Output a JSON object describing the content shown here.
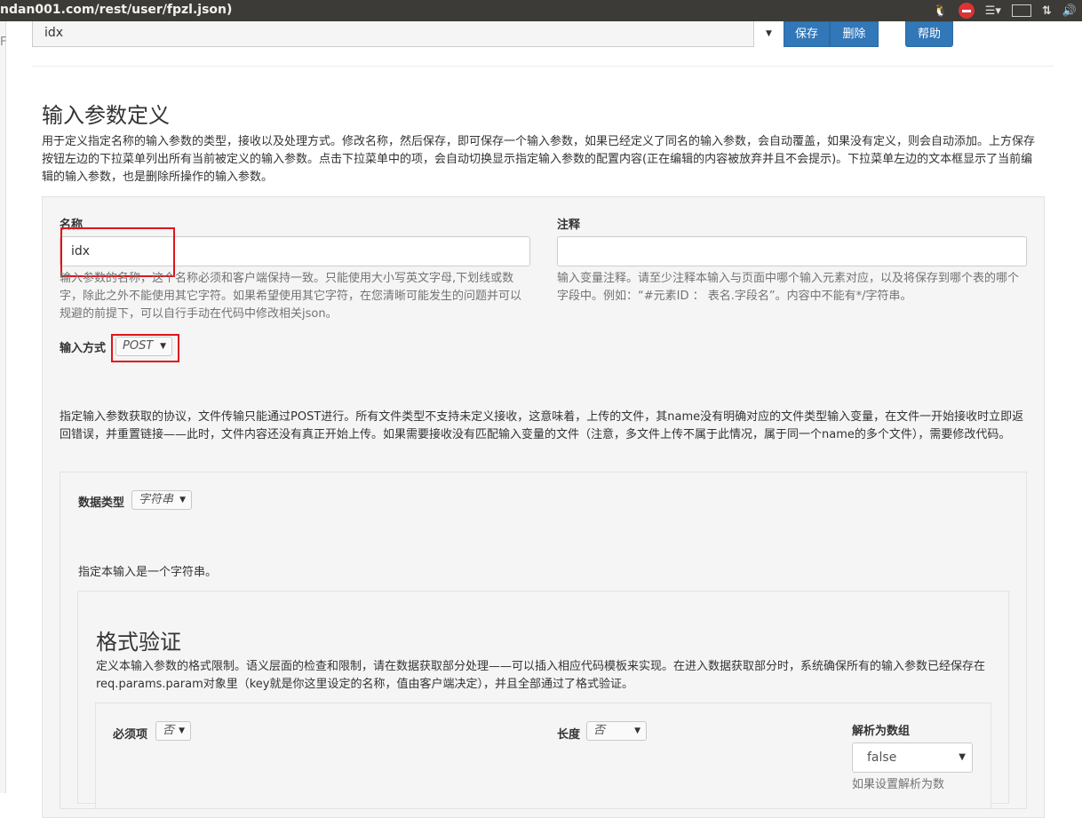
{
  "window": {
    "title": "ndan001.com/rest/user/fpzl.json)",
    "left_edge_text": "F"
  },
  "toolbar": {
    "selected_param": "idx",
    "save_label": "保存",
    "delete_label": "删除",
    "help_label": "帮助"
  },
  "section": {
    "title": "输入参数定义",
    "description": "用于定义指定名称的输入参数的类型，接收以及处理方式。修改名称，然后保存，即可保存一个输入参数，如果已经定义了同名的输入参数，会自动覆盖，如果没有定义，则会自动添加。上方保存按钮左边的下拉菜单列出所有当前被定义的输入参数。点击下拉菜单中的项，会自动切换显示指定输入参数的配置内容(正在编辑的内容被放弃并且不会提示)。下拉菜单左边的文本框显示了当前编辑的输入参数，也是删除所操作的输入参数。"
  },
  "form": {
    "name_label": "名称",
    "name_value": "idx",
    "name_help": "输入参数的名称，这个名称必须和客户端保持一致。只能使用大小写英文字母,下划线或数字，除此之外不能使用其它字符。如果希望使用其它字符，在您清晰可能发生的问题并可以规避的前提下，可以自行手动在代码中修改相关json。",
    "comment_label": "注释",
    "comment_value": "",
    "comment_help": "输入变量注释。请至少注释本输入与页面中哪个输入元素对应，以及将保存到哪个表的哪个字段中。例如：“#元素ID ： 表名.字段名”。内容中不能有*/字符串。",
    "method_label": "输入方式",
    "method_value": "POST",
    "method_help": "指定输入参数获取的协议，文件传输只能通过POST进行。所有文件类型不支持未定义接收，这意味着，上传的文件，其name没有明确对应的文件类型输入变量，在文件一开始接收时立即返回错误，并重置链接——此时，文件内容还没有真正开始上传。如果需要接收没有匹配输入变量的文件（注意，多文件上传不属于此情况，属于同一个name的多个文件），需要修改代码。",
    "datatype_label": "数据类型",
    "datatype_value": "字符串",
    "datatype_help": "指定本输入是一个字符串。"
  },
  "validation": {
    "title": "格式验证",
    "description": "定义本输入参数的格式限制。语义层面的检查和限制，请在数据获取部分处理——可以插入相应代码模板来实现。在进入数据获取部分时，系统确保所有的输入参数已经保存在req.params.param对象里（key就是你这里设定的名称，值由客户端决定），并且全部通过了格式验证。",
    "required_label": "必须项",
    "required_value": "否",
    "length_label": "长度",
    "length_value": "否",
    "array_label": "解析为数组",
    "array_value": "false",
    "array_help": "如果设置解析为数"
  },
  "colors": {
    "primary": "#3277b7",
    "highlight": "#e0141b",
    "well": "#f5f5f5",
    "topbar": "#3c3b37"
  }
}
